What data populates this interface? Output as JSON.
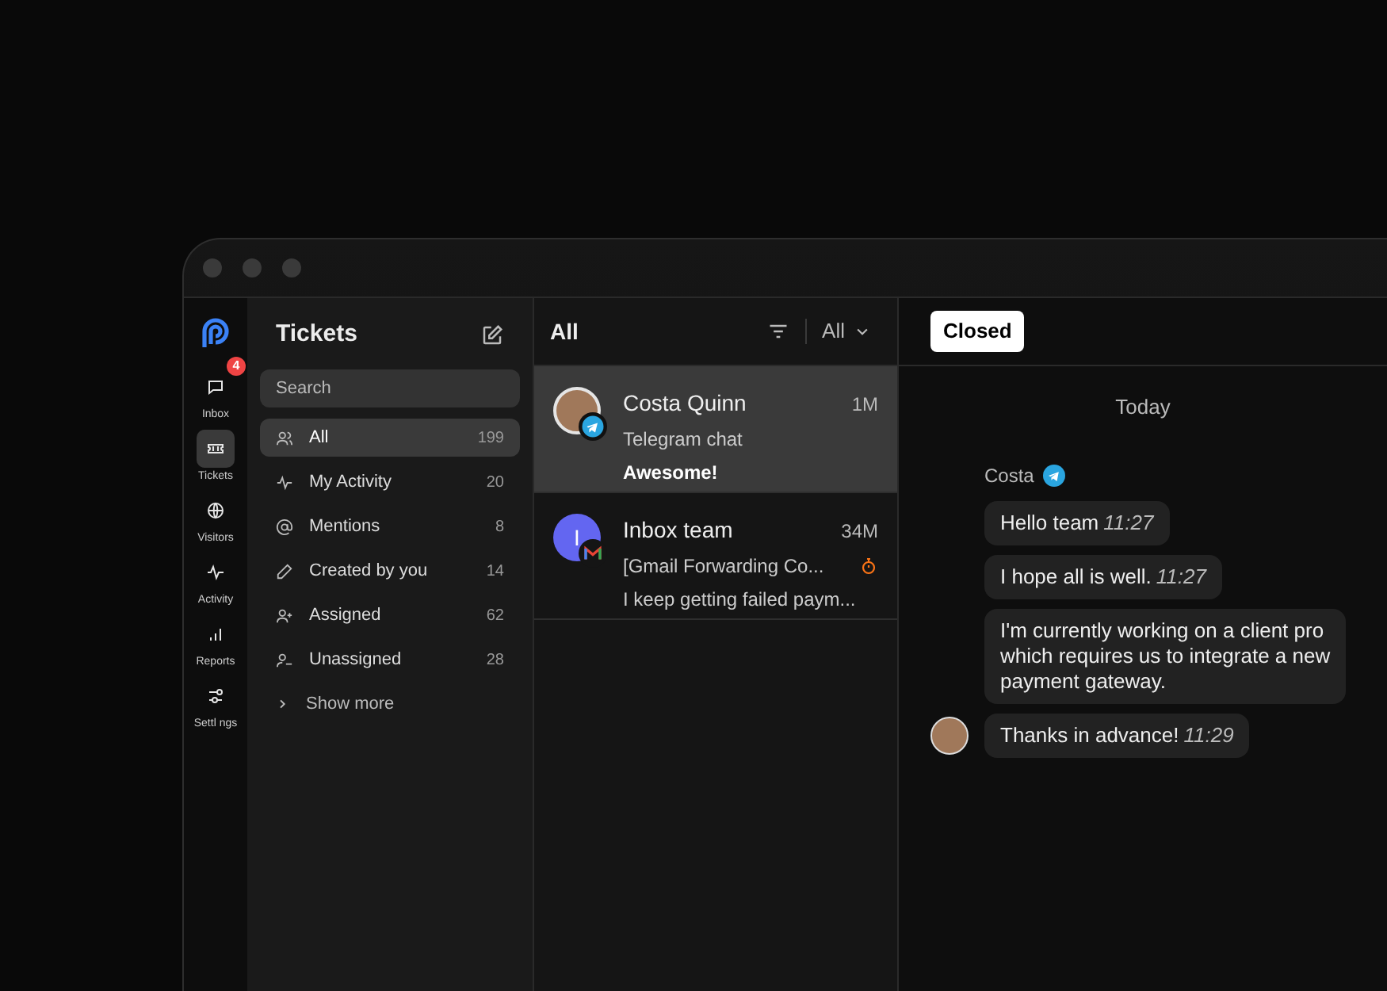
{
  "rail": [
    {
      "label": "Inbox",
      "badge": "4",
      "selected": false
    },
    {
      "label": "Tickets",
      "selected": true
    },
    {
      "label": "Visitors",
      "selected": false
    },
    {
      "label": "Activity",
      "selected": false
    },
    {
      "label": "Reports",
      "selected": false
    },
    {
      "label": "Settl ngs",
      "selected": false
    }
  ],
  "nav": {
    "title": "Tickets",
    "search": {
      "placeholder": "Search"
    },
    "items": [
      {
        "label": "All",
        "count": "199",
        "selected": true
      },
      {
        "label": "My Activity",
        "count": "20",
        "selected": false
      },
      {
        "label": "Mentions",
        "count": "8",
        "selected": false
      },
      {
        "label": "Created by you",
        "count": "14",
        "selected": false
      },
      {
        "label": "Assigned",
        "count": "62",
        "selected": false
      },
      {
        "label": "Unassigned",
        "count": "28",
        "selected": false
      }
    ],
    "show_more": "Show more"
  },
  "list": {
    "title": "All",
    "filter": "All",
    "conversations": [
      {
        "name": "Costa Quinn",
        "time": "1M",
        "subject": "Telegram chat",
        "preview": "Awesome!",
        "kind": "telegram",
        "timer": false,
        "selected": true
      },
      {
        "name": "Inbox team",
        "time": "34M",
        "subject": "[Gmail Forwarding Co...",
        "preview": "I keep getting failed paym...",
        "initial": "I",
        "kind": "gmail",
        "timer": true,
        "selected": false
      }
    ]
  },
  "chat": {
    "status": "Closed",
    "day": "Today",
    "sender": "Costa",
    "messages": [
      {
        "lines": [
          "Hello team"
        ],
        "time": "11:27",
        "avatar": false
      },
      {
        "lines": [
          "I hope all is well."
        ],
        "time": "11:27",
        "avatar": false
      },
      {
        "lines": [
          "I'm currently working on a client pro",
          "which requires us to integrate a new",
          "payment gateway."
        ],
        "avatar": false
      },
      {
        "lines": [
          "Thanks in advance!"
        ],
        "time": "11:29",
        "avatar": true
      }
    ]
  }
}
